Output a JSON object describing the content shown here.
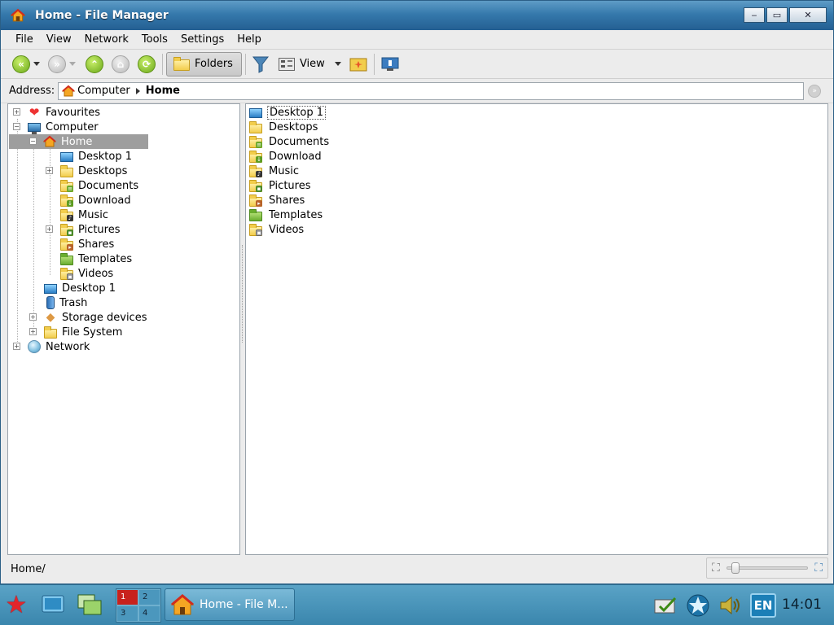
{
  "window": {
    "title": "Home - File Manager",
    "buttons": {
      "minimize": "‒",
      "maximize": "▭",
      "close": "✕"
    }
  },
  "menu": [
    "File",
    "View",
    "Network",
    "Tools",
    "Settings",
    "Help"
  ],
  "toolbar": {
    "back_icon": "«",
    "forward_icon": "»",
    "up_icon": "⌃",
    "home_icon": "⌂",
    "refresh_icon": "⟳",
    "folders_label": "Folders",
    "view_label": "View"
  },
  "address": {
    "label": "Address:",
    "crumbs": [
      "Computer",
      "Home"
    ]
  },
  "tree": {
    "favourites": "Favourites",
    "computer": "Computer",
    "home": "Home",
    "home_children": [
      "Desktop 1",
      "Desktops",
      "Documents",
      "Download",
      "Music",
      "Pictures",
      "Shares",
      "Templates",
      "Videos"
    ],
    "desktop": "Desktop 1",
    "trash": "Trash",
    "storage": "Storage devices",
    "filesystem": "File System",
    "network": "Network"
  },
  "files": [
    "Desktop 1",
    "Desktops",
    "Documents",
    "Download",
    "Music",
    "Pictures",
    "Shares",
    "Templates",
    "Videos"
  ],
  "status": {
    "path": "Home/",
    "zoom": 0.05
  },
  "taskbar": {
    "pager": [
      "1",
      "2",
      "3",
      "4"
    ],
    "task_label": "Home - File M...",
    "language": "EN",
    "clock": "14:01"
  },
  "colors": {
    "title_bar": "#3579ac",
    "selection": "#9e9e9e",
    "taskbar": "#4a94ba",
    "folder": "#f2cd4c"
  }
}
